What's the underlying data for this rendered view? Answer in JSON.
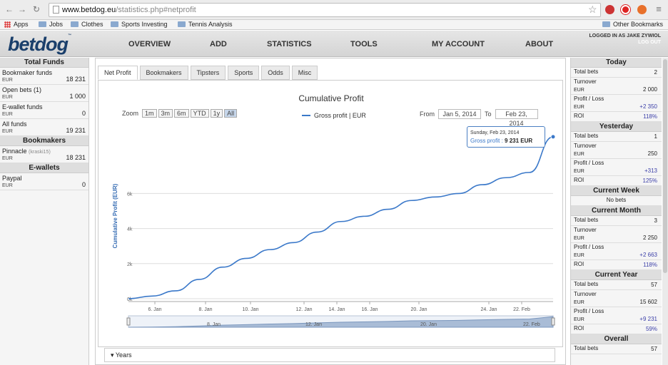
{
  "browser": {
    "url_host": "www.betdog.eu",
    "url_path": "/statistics.php#netprofit",
    "bookmarks": [
      "Apps",
      "Jobs",
      "Clothes",
      "Sports Investing",
      "Tennis Analysis"
    ],
    "other_bookmarks": "Other Bookmarks"
  },
  "header": {
    "logo": "betdog",
    "logo_tm": "™",
    "nav": [
      "OVERVIEW",
      "ADD",
      "STATISTICS",
      "TOOLS",
      "MY ACCOUNT",
      "ABOUT"
    ],
    "logged_in": "LOGGED IN AS JAKE ZYWIOL",
    "logout": "LOG OUT"
  },
  "left": {
    "total_funds_title": "Total Funds",
    "funds": [
      {
        "label": "Bookmaker funds",
        "sub": "EUR",
        "value": "18 231"
      },
      {
        "label": "Open bets (1)",
        "sub": "EUR",
        "value": "1 000"
      },
      {
        "label": "E-wallet funds",
        "sub": "EUR",
        "value": "0"
      },
      {
        "label": "All funds",
        "sub": "EUR",
        "value": "19 231"
      }
    ],
    "bookmakers_title": "Bookmakers",
    "bookmaker": {
      "label": "Pinnacle",
      "hint": "(kraski15)",
      "sub": "EUR",
      "value": "18 231"
    },
    "ewallets_title": "E-wallets",
    "ewallet": {
      "label": "Paypal",
      "sub": "EUR",
      "value": "0"
    }
  },
  "tabs": [
    "Net Profit",
    "Bookmakers",
    "Tipsters",
    "Sports",
    "Odds",
    "Misc"
  ],
  "chart_controls": {
    "zoom_label": "Zoom",
    "zoom_buttons": [
      "1m",
      "3m",
      "6m",
      "YTD",
      "1y",
      "All"
    ],
    "from_label": "From",
    "from_date": "Jan 5, 2014",
    "to_label": "To",
    "to_date": "Feb 23, 2014"
  },
  "tooltip": {
    "date": "Sunday, Feb 23, 2014",
    "series": "Gross profit",
    "value": "9 231 EUR"
  },
  "years_label": "Years",
  "chart_data": {
    "type": "line",
    "title": "Cumulative Profit",
    "ylabel": "Cumulative Profit (EUR)",
    "xlabel": "",
    "ylim": [
      0,
      10000
    ],
    "yticks": [
      "0k",
      "2k",
      "4k",
      "6k"
    ],
    "xticks": [
      "6. Jan",
      "8. Jan",
      "10. Jan",
      "12. Jan",
      "14. Jan",
      "16. Jan",
      "20. Jan",
      "24. Jan",
      "22. Feb"
    ],
    "navigator_ticks": [
      "8. Jan",
      "12. Jan",
      "20. Jan",
      "22. Feb"
    ],
    "series": [
      {
        "name": "Gross profit | EUR",
        "color": "#3a78c9",
        "values": [
          0,
          150,
          450,
          1100,
          1800,
          2300,
          2800,
          3200,
          3800,
          4400,
          4700,
          5100,
          5600,
          5800,
          6000,
          6500,
          6900,
          7200,
          9231
        ]
      }
    ]
  },
  "right": {
    "today_title": "Today",
    "today": [
      {
        "label": "Total bets",
        "value": "2"
      },
      {
        "label": "Turnover",
        "sub": "EUR",
        "value": "2 000"
      },
      {
        "label": "Profit / Loss",
        "sub": "EUR",
        "value": "+2 350"
      },
      {
        "label": "ROI",
        "value": "118%"
      }
    ],
    "yesterday_title": "Yesterday",
    "yesterday": [
      {
        "label": "Total bets",
        "value": "1"
      },
      {
        "label": "Turnover",
        "sub": "EUR",
        "value": "250"
      },
      {
        "label": "Profit / Loss",
        "sub": "EUR",
        "value": "+313"
      },
      {
        "label": "ROI",
        "value": "125%"
      }
    ],
    "week_title": "Current Week",
    "week_text": "No bets",
    "month_title": "Current Month",
    "month": [
      {
        "label": "Total bets",
        "value": "3"
      },
      {
        "label": "Turnover",
        "sub": "EUR",
        "value": "2 250"
      },
      {
        "label": "Profit / Loss",
        "sub": "EUR",
        "value": "+2 663"
      },
      {
        "label": "ROI",
        "value": "118%"
      }
    ],
    "year_title": "Current Year",
    "year": [
      {
        "label": "Total bets",
        "value": "57"
      },
      {
        "label": "Turnover",
        "sub": "EUR",
        "value": "15 602"
      },
      {
        "label": "Profit / Loss",
        "sub": "EUR",
        "value": "+9 231"
      },
      {
        "label": "ROI",
        "value": "59%"
      }
    ],
    "overall_title": "Overall",
    "overall": [
      {
        "label": "Total bets",
        "value": "57"
      }
    ]
  }
}
